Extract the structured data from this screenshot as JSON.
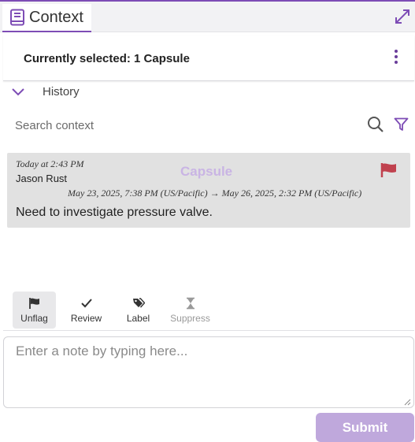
{
  "colors": {
    "accent": "#7d4cb5",
    "flag": "#c0414e",
    "capsule_label": "#c9b4e4",
    "submit_bg": "#bfa8dc"
  },
  "tab": {
    "label": "Context",
    "icon": "book-icon"
  },
  "header_icons": {
    "expand": "expand-arrows-icon"
  },
  "selection": {
    "title": "Currently selected: 1 Capsule",
    "menu_icon": "kebab-menu-icon"
  },
  "history": {
    "label": "History",
    "icon": "chevron-down-icon"
  },
  "search": {
    "placeholder": "Search context",
    "search_icon": "search-icon",
    "filter_icon": "filter-icon"
  },
  "annotation": {
    "timestamp": "Today at 2:43 PM",
    "author": "Jason Rust",
    "type_label": "Capsule",
    "flagged": true,
    "range": "May 23, 2025, 7:38 PM (US/Pacific) → May 26, 2025, 2:32 PM (US/Pacific)",
    "text": "Need to investigate pressure valve."
  },
  "actions": [
    {
      "label": "Unflag",
      "icon": "flag-icon",
      "active": true,
      "disabled": false
    },
    {
      "label": "Review",
      "icon": "checkmark-icon",
      "active": false,
      "disabled": false
    },
    {
      "label": "Label",
      "icon": "tags-icon",
      "active": false,
      "disabled": false
    },
    {
      "label": "Suppress",
      "icon": "hourglass-icon",
      "active": false,
      "disabled": true
    }
  ],
  "note": {
    "placeholder": "Enter a note by typing here...",
    "value": ""
  },
  "submit": {
    "label": "Submit"
  }
}
